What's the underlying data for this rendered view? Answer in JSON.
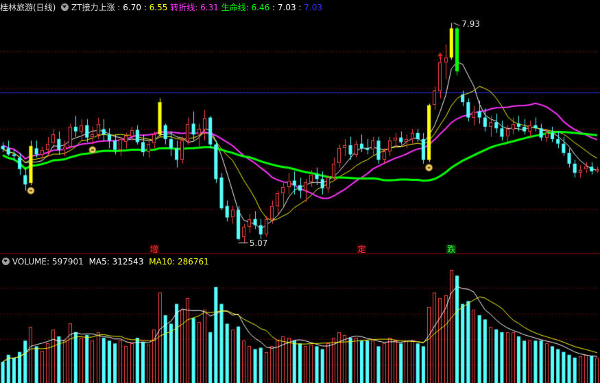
{
  "header": {
    "title": "桂林旅游(日线)",
    "indicator_name": "ZT接力上涨",
    "values": [
      {
        "label": "",
        "value": "6.70",
        "color": "#ffffff"
      },
      {
        "label": "",
        "value": "6.55",
        "color": "#ffff00"
      },
      {
        "label": "转折线",
        "value": "6.31",
        "color": "#ff33ff"
      },
      {
        "label": "生命线",
        "value": "6.46",
        "color": "#00ff00"
      },
      {
        "label": "",
        "value": "7.03",
        "color": "#ffffff"
      },
      {
        "label": "",
        "value": "7.03",
        "color": "#3333ff"
      }
    ]
  },
  "volume_header": {
    "label": "VOLUME",
    "value": "597901",
    "ma5_label": "MA5",
    "ma5_value": "312543",
    "ma10_label": "MA10",
    "ma10_value": "286761"
  },
  "markers": [
    {
      "text": "增",
      "color": "#ff3333",
      "bg": "#3a0000",
      "x_index": 27
    },
    {
      "text": "定",
      "color": "#ff3333",
      "bg": "#3a0000",
      "x_index": 64
    },
    {
      "text": "跌",
      "color": "#33ff33",
      "bg": "#003a00",
      "x_index": 80
    }
  ],
  "colors": {
    "up": "#ff4444",
    "down": "#54ffff",
    "zt": "#ffff00",
    "big_down": "#00ff00",
    "grid": "#7a0000",
    "axis": "#aa0000",
    "ma_white": "#ffffff",
    "ma_yellow": "#ffff00",
    "ma_magenta": "#ff33ff",
    "ma_green": "#00ff00",
    "ref_line": "#3333ff"
  },
  "chart_data": {
    "type": "candlestick",
    "annotations": {
      "high": "7.93",
      "low": "5.07",
      "ref_price": 7.03
    },
    "ylim": [
      4.95,
      8.05
    ],
    "candles": [
      [
        6.33,
        6.38,
        6.25,
        6.29
      ],
      [
        6.3,
        6.4,
        6.2,
        6.22
      ],
      [
        6.22,
        6.28,
        6.14,
        6.2
      ],
      [
        6.18,
        6.24,
        5.95,
        6.03
      ],
      [
        5.95,
        6.05,
        5.75,
        5.83
      ],
      [
        5.85,
        6.4,
        5.82,
        6.33
      ],
      [
        6.3,
        6.4,
        6.18,
        6.22
      ],
      [
        6.22,
        6.32,
        6.15,
        6.28
      ],
      [
        6.28,
        6.45,
        6.2,
        6.36
      ],
      [
        6.36,
        6.55,
        6.3,
        6.48
      ],
      [
        6.42,
        6.52,
        6.22,
        6.28
      ],
      [
        6.28,
        6.4,
        6.2,
        6.32
      ],
      [
        6.32,
        6.62,
        6.3,
        6.58
      ],
      [
        6.58,
        6.72,
        6.45,
        6.52
      ],
      [
        6.52,
        6.68,
        6.4,
        6.6
      ],
      [
        6.6,
        6.68,
        6.38,
        6.44
      ],
      [
        6.44,
        6.58,
        6.35,
        6.48
      ],
      [
        6.48,
        6.7,
        6.42,
        6.62
      ],
      [
        6.55,
        6.68,
        6.4,
        6.48
      ],
      [
        6.48,
        6.56,
        6.3,
        6.4
      ],
      [
        6.4,
        6.48,
        6.22,
        6.28
      ],
      [
        6.28,
        6.45,
        6.2,
        6.42
      ],
      [
        6.38,
        6.5,
        6.3,
        6.46
      ],
      [
        6.46,
        6.58,
        6.4,
        6.54
      ],
      [
        6.54,
        6.6,
        6.35,
        6.38
      ],
      [
        6.38,
        6.48,
        6.2,
        6.25
      ],
      [
        6.25,
        6.4,
        6.18,
        6.36
      ],
      [
        6.36,
        6.52,
        6.3,
        6.48
      ],
      [
        6.48,
        6.95,
        6.45,
        6.9
      ],
      [
        6.6,
        6.62,
        6.35,
        6.42
      ],
      [
        6.42,
        6.52,
        6.2,
        6.3
      ],
      [
        6.3,
        6.4,
        6.05,
        6.15
      ],
      [
        6.15,
        6.45,
        6.1,
        6.4
      ],
      [
        6.4,
        6.7,
        6.35,
        6.62
      ],
      [
        6.62,
        6.78,
        6.4,
        6.48
      ],
      [
        6.48,
        6.62,
        6.3,
        6.55
      ],
      [
        6.55,
        6.8,
        6.4,
        6.7
      ],
      [
        6.7,
        6.72,
        6.3,
        6.35
      ],
      [
        6.35,
        6.4,
        5.85,
        5.9
      ],
      [
        5.92,
        5.98,
        5.5,
        5.52
      ],
      [
        5.55,
        5.62,
        5.35,
        5.4
      ],
      [
        5.4,
        5.55,
        5.32,
        5.5
      ],
      [
        5.5,
        5.55,
        5.1,
        5.12
      ],
      [
        5.15,
        5.32,
        5.07,
        5.28
      ],
      [
        5.28,
        5.45,
        5.2,
        5.38
      ],
      [
        5.38,
        5.48,
        5.25,
        5.3
      ],
      [
        5.3,
        5.38,
        5.12,
        5.18
      ],
      [
        5.18,
        5.42,
        5.15,
        5.38
      ],
      [
        5.38,
        5.62,
        5.32,
        5.55
      ],
      [
        5.55,
        5.75,
        5.45,
        5.72
      ],
      [
        5.72,
        5.85,
        5.55,
        5.8
      ],
      [
        5.8,
        5.98,
        5.7,
        5.88
      ],
      [
        5.88,
        6.0,
        5.7,
        5.82
      ],
      [
        5.82,
        5.92,
        5.65,
        5.75
      ],
      [
        5.75,
        5.9,
        5.6,
        5.86
      ],
      [
        5.86,
        6.02,
        5.8,
        5.96
      ],
      [
        5.96,
        6.05,
        5.82,
        5.9
      ],
      [
        5.9,
        6.0,
        5.7,
        5.78
      ],
      [
        5.78,
        5.95,
        5.72,
        5.92
      ],
      [
        5.92,
        6.18,
        5.88,
        6.1
      ],
      [
        6.1,
        6.35,
        6.05,
        6.3
      ],
      [
        6.3,
        6.42,
        6.2,
        6.34
      ],
      [
        6.34,
        6.45,
        6.15,
        6.22
      ],
      [
        6.22,
        6.4,
        6.18,
        6.36
      ],
      [
        6.36,
        6.48,
        6.25,
        6.3
      ],
      [
        6.3,
        6.42,
        6.22,
        6.28
      ],
      [
        6.28,
        6.45,
        6.2,
        6.4
      ],
      [
        6.4,
        6.45,
        6.1,
        6.15
      ],
      [
        6.15,
        6.3,
        6.1,
        6.26
      ],
      [
        6.26,
        6.45,
        6.2,
        6.4
      ],
      [
        6.4,
        6.5,
        6.32,
        6.44
      ],
      [
        6.44,
        6.52,
        6.35,
        6.38
      ],
      [
        6.38,
        6.48,
        6.3,
        6.42
      ],
      [
        6.42,
        6.55,
        6.36,
        6.5
      ],
      [
        6.5,
        6.55,
        6.38,
        6.42
      ],
      [
        6.42,
        6.5,
        6.1,
        6.15
      ],
      [
        6.15,
        6.88,
        6.12,
        6.86
      ],
      [
        6.86,
        7.1,
        6.8,
        7.05
      ],
      [
        7.05,
        7.5,
        6.95,
        7.42
      ],
      [
        7.42,
        7.65,
        7.2,
        7.48
      ],
      [
        7.48,
        7.93,
        7.45,
        7.86
      ],
      [
        7.86,
        7.88,
        7.25,
        7.3
      ],
      [
        7.0,
        7.05,
        6.85,
        6.9
      ],
      [
        6.9,
        6.95,
        6.65,
        6.7
      ],
      [
        6.7,
        6.85,
        6.6,
        6.78
      ],
      [
        6.78,
        6.92,
        6.62,
        6.7
      ],
      [
        6.7,
        6.82,
        6.52,
        6.58
      ],
      [
        6.58,
        6.72,
        6.45,
        6.64
      ],
      [
        6.64,
        6.75,
        6.5,
        6.56
      ],
      [
        6.56,
        6.66,
        6.4,
        6.45
      ],
      [
        6.45,
        6.6,
        6.38,
        6.55
      ],
      [
        6.55,
        6.7,
        6.48,
        6.62
      ],
      [
        6.62,
        6.72,
        6.52,
        6.58
      ],
      [
        6.58,
        6.68,
        6.48,
        6.52
      ],
      [
        6.52,
        6.66,
        6.45,
        6.6
      ],
      [
        6.6,
        6.7,
        6.52,
        6.56
      ],
      [
        6.56,
        6.62,
        6.4,
        6.44
      ],
      [
        6.44,
        6.55,
        6.38,
        6.5
      ],
      [
        6.5,
        6.58,
        6.38,
        6.42
      ],
      [
        6.42,
        6.52,
        6.3,
        6.36
      ],
      [
        6.36,
        6.45,
        6.2,
        6.24
      ],
      [
        6.24,
        6.3,
        6.05,
        6.1
      ],
      [
        6.1,
        6.15,
        5.92,
        5.98
      ],
      [
        5.98,
        6.08,
        5.92,
        6.02
      ],
      [
        6.02,
        6.12,
        5.98,
        6.06
      ],
      [
        6.06,
        6.12,
        5.96,
        6.0
      ],
      [
        6.0,
        6.06,
        5.98,
        6.03
      ]
    ],
    "zt_indices": [
      5,
      28,
      76,
      80
    ],
    "coin_indices": [
      5,
      16,
      76
    ],
    "volume": [
      150,
      200,
      180,
      220,
      300,
      400,
      260,
      230,
      280,
      380,
      330,
      300,
      420,
      360,
      320,
      340,
      300,
      360,
      320,
      300,
      280,
      300,
      260,
      280,
      320,
      290,
      270,
      380,
      640,
      480,
      420,
      560,
      520,
      600,
      460,
      430,
      520,
      360,
      680,
      560,
      420,
      380,
      400,
      300,
      260,
      240,
      250,
      220,
      260,
      300,
      330,
      320,
      300,
      280,
      260,
      270,
      260,
      240,
      280,
      320,
      360,
      340,
      320,
      320,
      300,
      300,
      300,
      260,
      280,
      320,
      300,
      280,
      300,
      300,
      280,
      260,
      540,
      640,
      600,
      620,
      800,
      760,
      560,
      580,
      520,
      480,
      450,
      400,
      380,
      360,
      360,
      360,
      330,
      300,
      300,
      300,
      300,
      280,
      260,
      240,
      220,
      200,
      180,
      190,
      200,
      190,
      180
    ]
  }
}
